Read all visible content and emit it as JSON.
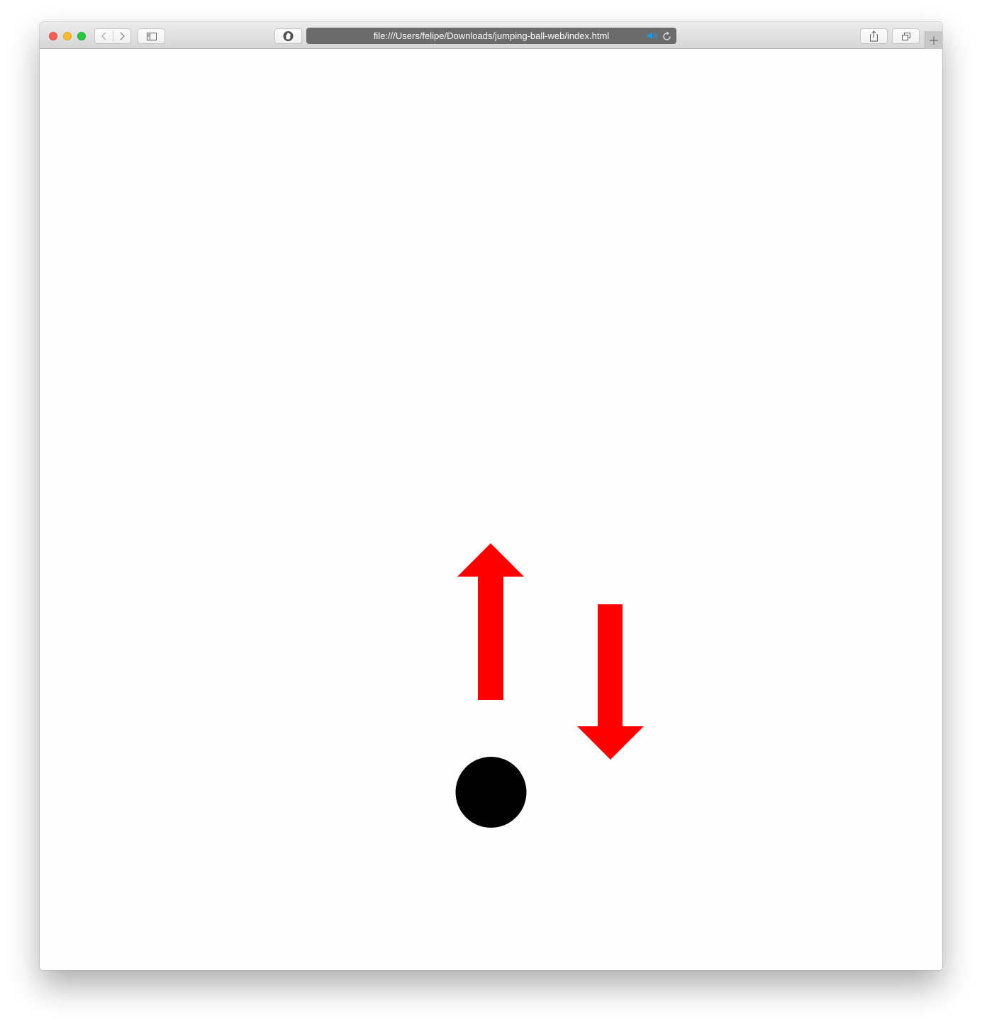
{
  "browser": {
    "url": "file:///Users/felipe/Downloads/jumping-ball-web/index.html",
    "icons": {
      "back": "chevron-left-icon",
      "forward": "chevron-right-icon",
      "sidebar": "sidebar-icon",
      "shield": "privacy-shield-icon",
      "speaker": "speaker-playing-icon",
      "reload": "reload-icon",
      "share": "share-icon",
      "tabs": "tab-overview-icon",
      "new_tab": "plus-icon"
    },
    "colors": {
      "close": "#fc5f57",
      "minimize": "#fdbc2e",
      "maximize": "#28c840",
      "speaker_accent": "#1a9be8"
    }
  },
  "scene": {
    "elements": [
      "up-arrow",
      "down-arrow",
      "ball"
    ],
    "arrow_color": "#ff0000",
    "ball_color": "#000000"
  }
}
